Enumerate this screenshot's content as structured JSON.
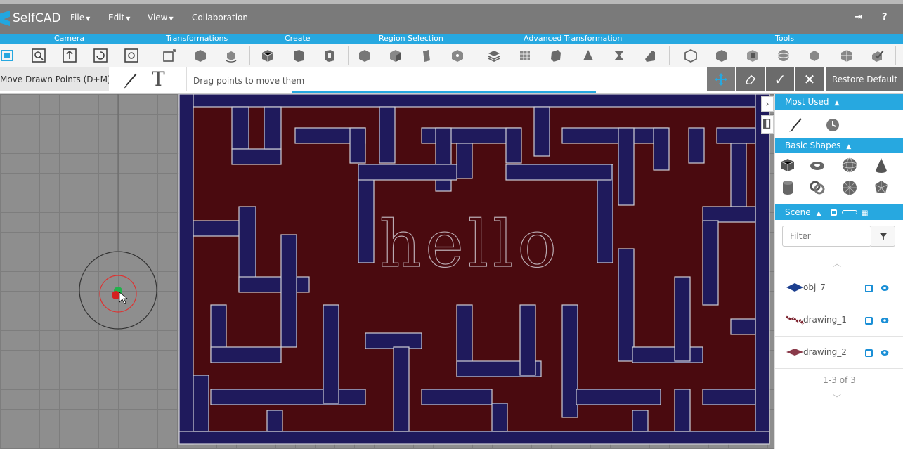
{
  "app": {
    "title": "SelfCAD",
    "menus": [
      {
        "label": "File"
      },
      {
        "label": "Edit"
      },
      {
        "label": "View"
      },
      {
        "label": "Collaboration"
      }
    ],
    "brand_color": "#27a8e0"
  },
  "categories": [
    {
      "label": "Camera"
    },
    {
      "label": "Transformations"
    },
    {
      "label": "Create"
    },
    {
      "label": "Region Selection"
    },
    {
      "label": "Advanced Transformation"
    },
    {
      "label": "Tools"
    }
  ],
  "subbar": {
    "tool_name": "Move Drawn Points (D+M)",
    "hint": "Drag points to move them",
    "text_tool": "T",
    "accept": "✓",
    "cancel": "✕",
    "restore_label": "Restore Default"
  },
  "viewport": {
    "maze_text": "hello",
    "maze_floor_color": "#4a0a0f",
    "maze_wall_color": "#1f1a5c"
  },
  "panel": {
    "most_used": "Most Used",
    "basic_shapes": "Basic Shapes",
    "scene": "Scene",
    "filter_placeholder": "Filter",
    "objects": [
      {
        "name": "obj_7",
        "color": "#1c3f8f"
      },
      {
        "name": "drawing_1",
        "color": "#7a1f2b"
      },
      {
        "name": "drawing_2",
        "color": "#8a3a4a"
      }
    ],
    "pager": "1-3 of 3"
  }
}
